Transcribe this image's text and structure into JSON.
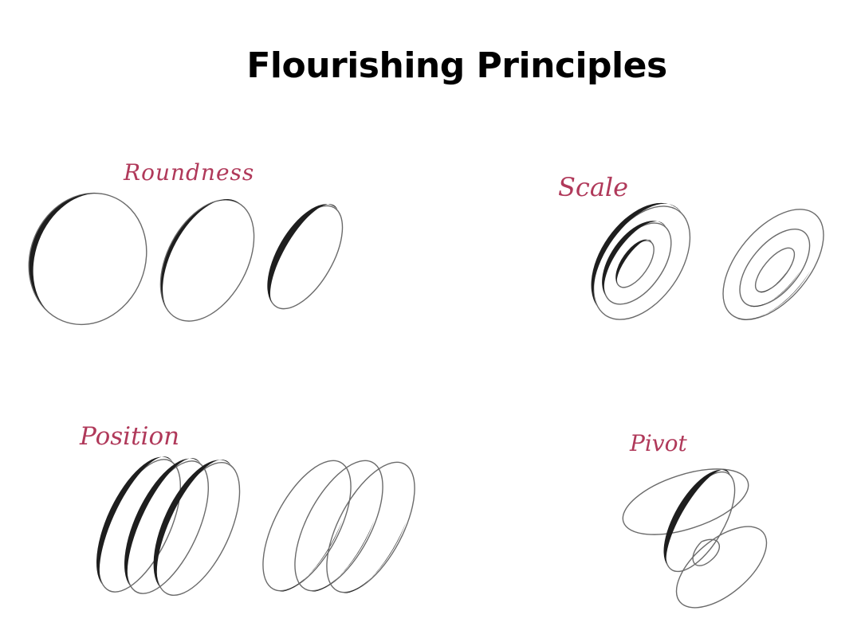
{
  "title": "Flourishing Principles",
  "sections": {
    "roundness": {
      "label": "Roundness"
    },
    "scale": {
      "label": "Scale"
    },
    "position": {
      "label": "Position"
    },
    "pivot": {
      "label": "Pivot"
    }
  },
  "colors": {
    "title": "#000000",
    "label": "#b0395a",
    "ink": "#1e1e1e",
    "hairline": "#6b6b6b",
    "background": "#ffffff"
  }
}
